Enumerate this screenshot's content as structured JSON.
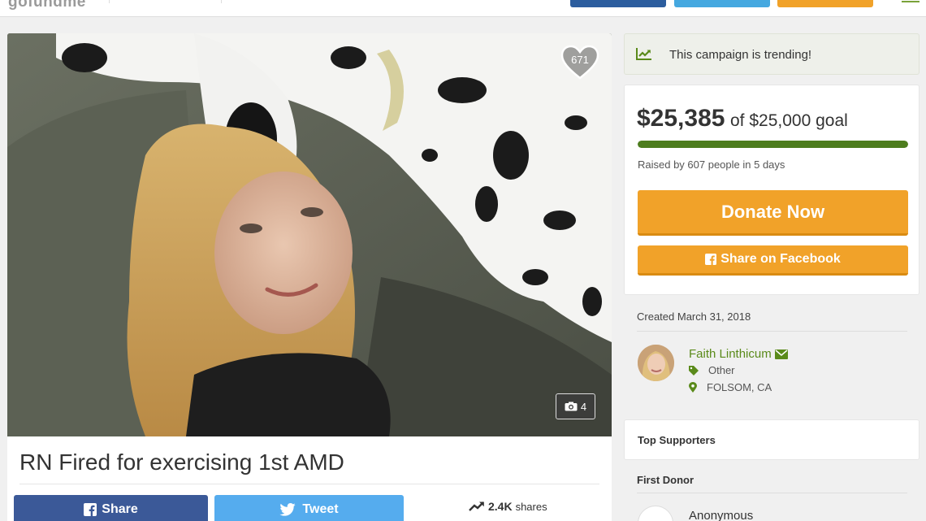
{
  "header": {
    "logo": "gofundme",
    "buttons": [
      {
        "color": "#2c5d9e"
      },
      {
        "color": "#45a8e0"
      },
      {
        "color": "#f1a229"
      }
    ]
  },
  "hero": {
    "heart_count": "671",
    "photo_count": "4"
  },
  "campaign": {
    "title": "RN Fired for exercising 1st AMD",
    "share_label": "Share",
    "tweet_label": "Tweet",
    "shares_count": "2.4K",
    "shares_label": "shares"
  },
  "sidebar": {
    "trending_text": "This campaign is trending!",
    "amount_raised": "$25,385",
    "goal_text": "of $25,000 goal",
    "progress_fraction": 1.0,
    "raised_by": "Raised by 607 people in 5 days",
    "donate_label": "Donate Now",
    "facebook_label": "Share on Facebook",
    "created": "Created March 31, 2018",
    "organizer": {
      "name": "Faith Linthicum",
      "category": "Other",
      "location": "FOLSOM, CA"
    },
    "top_supporters": "Top Supporters",
    "first_donor_heading": "First Donor",
    "first_donor_name": "Anonymous"
  },
  "colors": {
    "accent_green": "#5a8a1a",
    "progress_green": "#4d7d1e",
    "donate_orange": "#f1a229",
    "facebook_blue": "#3b5998",
    "twitter_blue": "#55acee"
  }
}
